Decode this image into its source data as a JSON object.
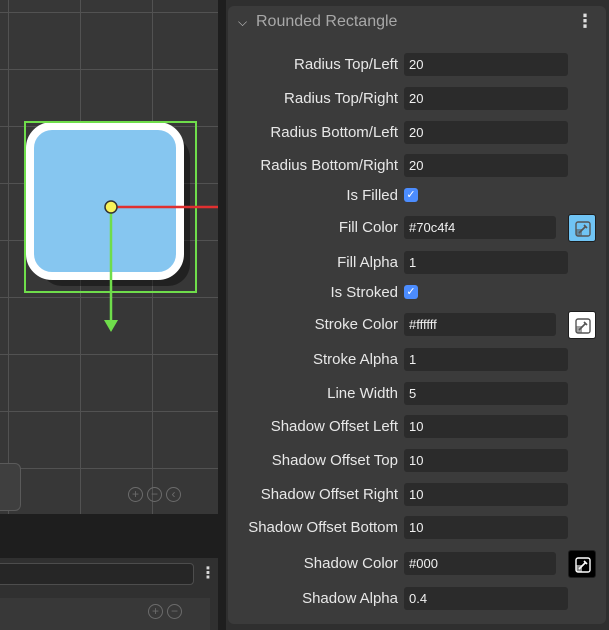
{
  "inspector": {
    "title": "Rounded Rectangle",
    "properties": [
      {
        "label": "Radius Top/Left",
        "type": "number",
        "value": "20"
      },
      {
        "label": "Radius Top/Right",
        "type": "number",
        "value": "20"
      },
      {
        "label": "Radius Bottom/Left",
        "type": "number",
        "value": "20"
      },
      {
        "label": "Radius Bottom/Right",
        "type": "number",
        "value": "20"
      },
      {
        "label": "Is Filled",
        "type": "checkbox",
        "checked": true
      },
      {
        "label": "Fill Color",
        "type": "color",
        "value": "#70c4f4",
        "swatch": "#70c4f4"
      },
      {
        "label": "Fill Alpha",
        "type": "number",
        "value": "1"
      },
      {
        "label": "Is Stroked",
        "type": "checkbox",
        "checked": true
      },
      {
        "label": "Stroke Color",
        "type": "color",
        "value": "#ffffff",
        "swatch": "#ffffff"
      },
      {
        "label": "Stroke Alpha",
        "type": "number",
        "value": "1"
      },
      {
        "label": "Line Width",
        "type": "number",
        "value": "5"
      },
      {
        "label": "Shadow Offset Left",
        "type": "number",
        "value": "10"
      },
      {
        "label": "Shadow Offset Top",
        "type": "number",
        "value": "10"
      },
      {
        "label": "Shadow Offset Right",
        "type": "number",
        "value": "10"
      },
      {
        "label": "Shadow Offset Bottom",
        "type": "number",
        "value": "10"
      },
      {
        "label": "Shadow Color",
        "type": "color",
        "value": "#000",
        "swatch": "#000000"
      },
      {
        "label": "Shadow Alpha",
        "type": "number",
        "value": "0.4"
      }
    ]
  },
  "scene": {
    "shape_fill": "#86c6f0",
    "shape_stroke": "#ffffff",
    "selection_color": "#6fdd4b",
    "x_axis_color": "#e03030",
    "y_axis_color": "#6fdd4b",
    "handle_color": "#f7f25a",
    "zoom_icons": [
      "zoom-in-icon",
      "zoom-out-icon",
      "zoom-reset-icon"
    ]
  },
  "colors": {
    "checkbox_accent": "#4c8dff",
    "panel_bg": "#3b3b3b",
    "field_bg": "#2b2b2b"
  }
}
